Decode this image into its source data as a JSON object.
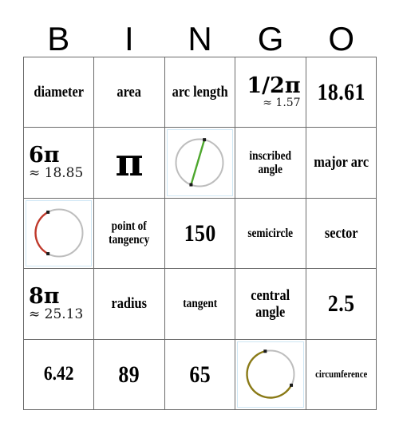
{
  "title": "Circles Bingo Card",
  "header": {
    "letters": [
      "B",
      "I",
      "N",
      "G",
      "O"
    ]
  },
  "colors": {
    "grid_line": "#6b6b6b",
    "text": "#000000",
    "image_cell_border": "#cfe7f5",
    "circle_outline": "#bdbdbd",
    "chord_green": "#4ea72e",
    "arc_red": "#c0392b",
    "arc_olive": "#8a7a16",
    "endpoint_dot": "#1a1a1a"
  },
  "grid": {
    "columns": 5,
    "rows": 5,
    "cells": [
      {
        "id": "b1",
        "type": "text",
        "style": "word",
        "text": "diameter"
      },
      {
        "id": "i1",
        "type": "text",
        "style": "word",
        "text": "area"
      },
      {
        "id": "n1",
        "type": "text",
        "style": "word",
        "text": "arc length"
      },
      {
        "id": "g1",
        "type": "pi",
        "align": "right",
        "main": "1/2π",
        "approx": "≈ 1.57"
      },
      {
        "id": "o1",
        "type": "text",
        "style": "num",
        "text": "18.61"
      },
      {
        "id": "b2",
        "type": "pi",
        "align": "left",
        "main": "6π",
        "approx": "≈ 18.85"
      },
      {
        "id": "i2",
        "type": "bigpi",
        "text": "π"
      },
      {
        "id": "n2",
        "type": "image",
        "image": "circle-with-green-chord"
      },
      {
        "id": "g2",
        "type": "text",
        "style": "word-sm",
        "text": "inscribed angle"
      },
      {
        "id": "o2",
        "type": "text",
        "style": "word",
        "text": "major arc"
      },
      {
        "id": "b3",
        "type": "image",
        "image": "circle-with-red-arc"
      },
      {
        "id": "i3",
        "type": "text",
        "style": "word-sm",
        "text": "point of tangency"
      },
      {
        "id": "n3",
        "type": "text",
        "style": "num",
        "text": "150"
      },
      {
        "id": "g3",
        "type": "text",
        "style": "word-sm",
        "text": "semicircle"
      },
      {
        "id": "o3",
        "type": "text",
        "style": "word",
        "text": "sector"
      },
      {
        "id": "b4",
        "type": "pi",
        "align": "left",
        "main": "8π",
        "approx": "≈ 25.13"
      },
      {
        "id": "i4",
        "type": "text",
        "style": "word",
        "text": "radius"
      },
      {
        "id": "n4",
        "type": "text",
        "style": "word-sm",
        "text": "tangent"
      },
      {
        "id": "g4",
        "type": "text",
        "style": "word",
        "text": "central angle"
      },
      {
        "id": "o4",
        "type": "text",
        "style": "num",
        "text": "2.5"
      },
      {
        "id": "b5",
        "type": "text",
        "style": "num-sm",
        "text": "6.42"
      },
      {
        "id": "i5",
        "type": "text",
        "style": "num",
        "text": "89"
      },
      {
        "id": "n5",
        "type": "text",
        "style": "num",
        "text": "65"
      },
      {
        "id": "g5",
        "type": "image",
        "image": "circle-with-olive-major-arc"
      },
      {
        "id": "o5",
        "type": "text",
        "style": "word-xs",
        "text": "circumference"
      }
    ]
  }
}
